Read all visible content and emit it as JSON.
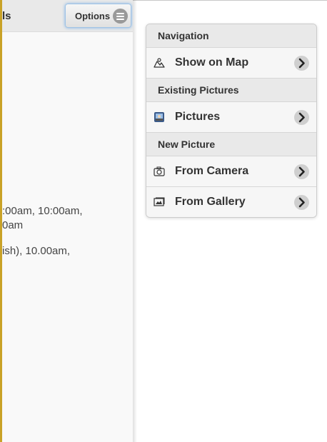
{
  "left_panel": {
    "title_fragment": "ls",
    "options_label": "Options",
    "text_lines": [
      ":00am, 10:00am,",
      "0am",
      "ish), 10.00am,"
    ]
  },
  "menu": {
    "sections": [
      {
        "header": "Navigation",
        "items": [
          {
            "label": "Show on Map",
            "icon": "map-icon"
          }
        ]
      },
      {
        "header": "Existing Pictures",
        "items": [
          {
            "label": "Pictures",
            "icon": "pictures-icon"
          }
        ]
      },
      {
        "header": "New Picture",
        "items": [
          {
            "label": "From Camera",
            "icon": "camera-icon"
          },
          {
            "label": "From Gallery",
            "icon": "gallery-icon"
          }
        ]
      }
    ]
  },
  "colors": {
    "accent_border": "#c9a227",
    "focus_glow": "#7fb2e5",
    "divider_bg": "#e9e9e9",
    "item_bg": "#f6f6f6"
  }
}
